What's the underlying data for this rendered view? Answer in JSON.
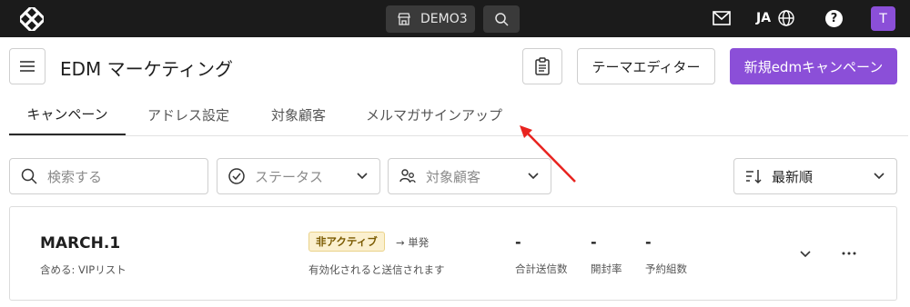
{
  "topbar": {
    "logo_icon": "app-logo-icon",
    "store_name": "DEMO3",
    "language": "JA",
    "help_symbol": "?",
    "avatar_initial": "T"
  },
  "header": {
    "title": "EDM マーケティング",
    "theme_editor_label": "テーマエディター",
    "new_campaign_label": "新規edmキャンペーン",
    "accent_color": "#8b4fd8"
  },
  "tabs": [
    {
      "label": "キャンペーン",
      "active": true
    },
    {
      "label": "アドレス設定",
      "active": false
    },
    {
      "label": "対象顧客",
      "active": false
    },
    {
      "label": "メルマガサインアップ",
      "active": false
    }
  ],
  "filters": {
    "search_placeholder": "検索する",
    "status_label": "ステータス",
    "audience_label": "対象顧客",
    "sort_label": "最新順"
  },
  "campaign": {
    "name": "MARCH.1",
    "includes": "含める: VIPリスト",
    "status_badge": "非アクティブ",
    "type": "→ 単発",
    "status_desc": "有効化されると送信されます",
    "metrics": [
      {
        "value": "-",
        "label": "合計送信数"
      },
      {
        "value": "-",
        "label": "開封率"
      },
      {
        "value": "-",
        "label": "予約組数"
      }
    ]
  }
}
